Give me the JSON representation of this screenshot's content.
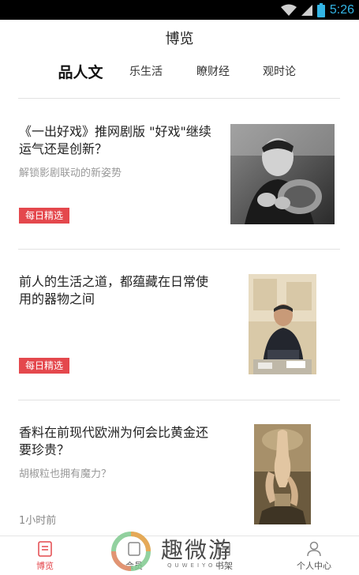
{
  "status_bar": {
    "time": "5:26"
  },
  "header": {
    "title": "博览"
  },
  "tabs": [
    {
      "label": "品人文",
      "active": true
    },
    {
      "label": "乐生活",
      "active": false
    },
    {
      "label": "瞭财经",
      "active": false
    },
    {
      "label": "观时论",
      "active": false
    }
  ],
  "articles": [
    {
      "title": "《一出好戏》推网剧版 \"好戏\"继续运气还是创新？",
      "subtitle": "解锁影剧联动的新姿势",
      "badge": "每日精选",
      "image": "portrait-man-bw-photo"
    },
    {
      "title": "前人的生活之道，都蕴藏在日常使用的器物之间",
      "subtitle": "",
      "badge": "每日精选",
      "image": "speaker-on-stage-photo"
    },
    {
      "title": "香料在前现代欧洲为何会比黄金还要珍贵？",
      "subtitle": "胡椒粒也拥有魔力？",
      "time": "1小时前",
      "image": "classical-painting"
    }
  ],
  "bottom_nav": [
    {
      "label": "博览",
      "icon": "document-icon",
      "active": true
    },
    {
      "label": "会员",
      "icon": "member-icon",
      "active": false
    },
    {
      "label": "书架",
      "icon": "bookshelf-icon",
      "active": false
    },
    {
      "label": "个人中心",
      "icon": "person-icon",
      "active": false
    }
  ],
  "watermark": {
    "text": "趣微游",
    "sub": "QUWEIYOU"
  },
  "colors": {
    "accent": "#e4484d",
    "status_time": "#33b5e5"
  }
}
